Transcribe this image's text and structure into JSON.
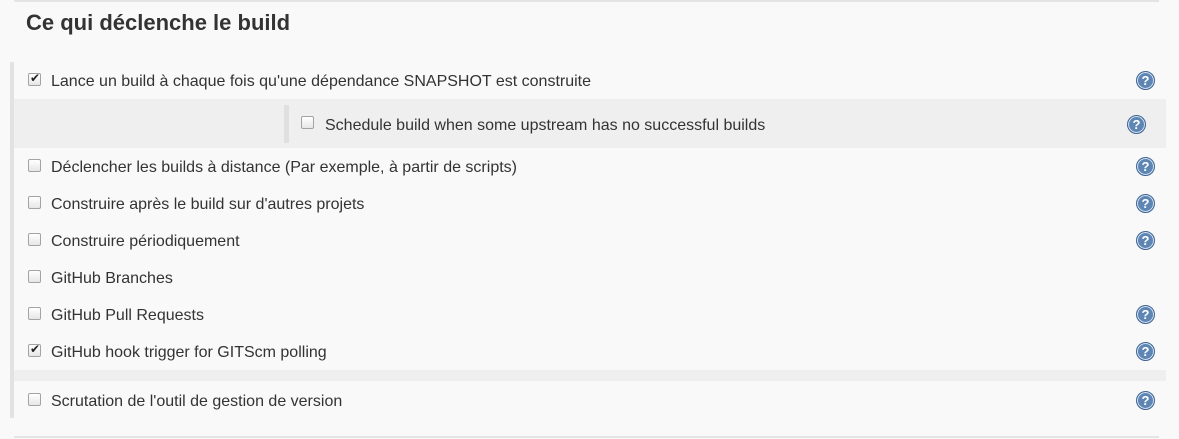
{
  "section": {
    "title": "Ce qui déclenche le build"
  },
  "triggers": [
    {
      "label": "Lance un build à chaque fois qu'une dépendance SNAPSHOT est construite",
      "checked": true,
      "help": true
    },
    {
      "label": "Déclencher les builds à distance (Par exemple, à partir de scripts)",
      "checked": false,
      "help": true
    },
    {
      "label": "Construire après le build sur d'autres projets",
      "checked": false,
      "help": true
    },
    {
      "label": "Construire périodiquement",
      "checked": false,
      "help": true
    },
    {
      "label": "GitHub Branches",
      "checked": false,
      "help": false
    },
    {
      "label": "GitHub Pull Requests",
      "checked": false,
      "help": true
    },
    {
      "label": "GitHub hook trigger for GITScm polling",
      "checked": true,
      "help": true
    },
    {
      "label": "Scrutation de l'outil de gestion de version",
      "checked": false,
      "help": true
    }
  ],
  "nested_option": {
    "label": "Schedule build when some upstream has no successful builds",
    "checked": false,
    "help": true
  },
  "help_glyph": "?",
  "check_glyph": "✔",
  "colors": {
    "help_icon": "#5e86b4",
    "nested_background": "#efefef",
    "panel_background": "#f9f9f9"
  }
}
